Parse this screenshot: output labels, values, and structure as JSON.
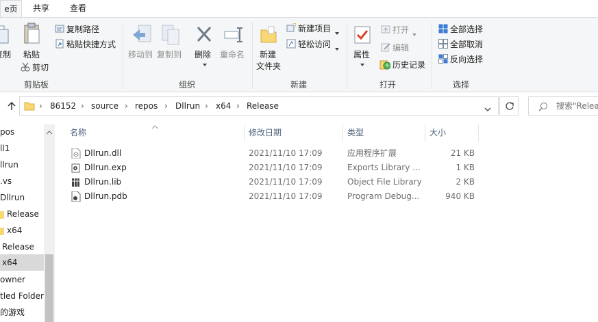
{
  "tabs": [
    {
      "label": "主页",
      "display": "e页"
    },
    {
      "label": "共享"
    },
    {
      "label": "查看"
    }
  ],
  "ribbon": {
    "clipboard": {
      "copy_label": "复制",
      "paste_label": "粘贴",
      "cut_label": "剪切",
      "copy_path_label": "复制路径",
      "paste_shortcut_label": "粘贴快捷方式",
      "group_label": "剪贴板"
    },
    "organize": {
      "move_to_label": "移动到",
      "copy_to_label": "复制到",
      "delete_label": "删除",
      "rename_label": "重命名",
      "group_label": "组织"
    },
    "new": {
      "new_folder_label_1": "新建",
      "new_folder_label_2": "文件夹",
      "new_item_label": "新建项目",
      "easy_access_label": "轻松访问",
      "group_label": "新建"
    },
    "open": {
      "properties_label": "属性",
      "open_label": "打开",
      "edit_label": "编辑",
      "history_label": "历史记录",
      "group_label": "打开"
    },
    "select": {
      "select_all_label": "全部选择",
      "select_none_label": "全部取消",
      "invert_label": "反向选择",
      "group_label": "选择"
    }
  },
  "address": {
    "crumbs": [
      "86152",
      "source",
      "repos",
      "Dllrun",
      "x64",
      "Release"
    ],
    "search_placeholder": "搜索\"Release\""
  },
  "nav": {
    "items": [
      {
        "label": "pos"
      },
      {
        "label": "ll1"
      },
      {
        "label": "llrun"
      },
      {
        "label": ".vs"
      },
      {
        "label": "Dllrun"
      },
      {
        "label": "Release",
        "icon": "folder-icon"
      },
      {
        "label": "x64",
        "icon": "folder-icon"
      },
      {
        "label": "Release"
      },
      {
        "label": "x64",
        "selected": true
      },
      {
        "label": "owner"
      },
      {
        "label": "tled Folder"
      },
      {
        "label": "的游戏"
      }
    ]
  },
  "filelist": {
    "columns": {
      "name": "名称",
      "date": "修改日期",
      "type": "类型",
      "size": "大小"
    },
    "rows": [
      {
        "name": "Dllrun.dll",
        "date": "2021/11/10 17:09",
        "type": "应用程序扩展",
        "size": "21 KB",
        "icon": "dll-file-icon"
      },
      {
        "name": "Dllrun.exp",
        "date": "2021/11/10 17:09",
        "type": "Exports Library ...",
        "size": "1 KB",
        "icon": "exp-file-icon"
      },
      {
        "name": "Dllrun.lib",
        "date": "2021/11/10 17:09",
        "type": "Object File Library",
        "size": "2 KB",
        "icon": "lib-file-icon"
      },
      {
        "name": "Dllrun.pdb",
        "date": "2021/11/10 17:09",
        "type": "Program Debug...",
        "size": "940 KB",
        "icon": "pdb-file-icon"
      }
    ]
  },
  "colors": {
    "accent": "#1e88e5",
    "folder": "#f8d775",
    "selected_nav": "#d9d9d9"
  }
}
